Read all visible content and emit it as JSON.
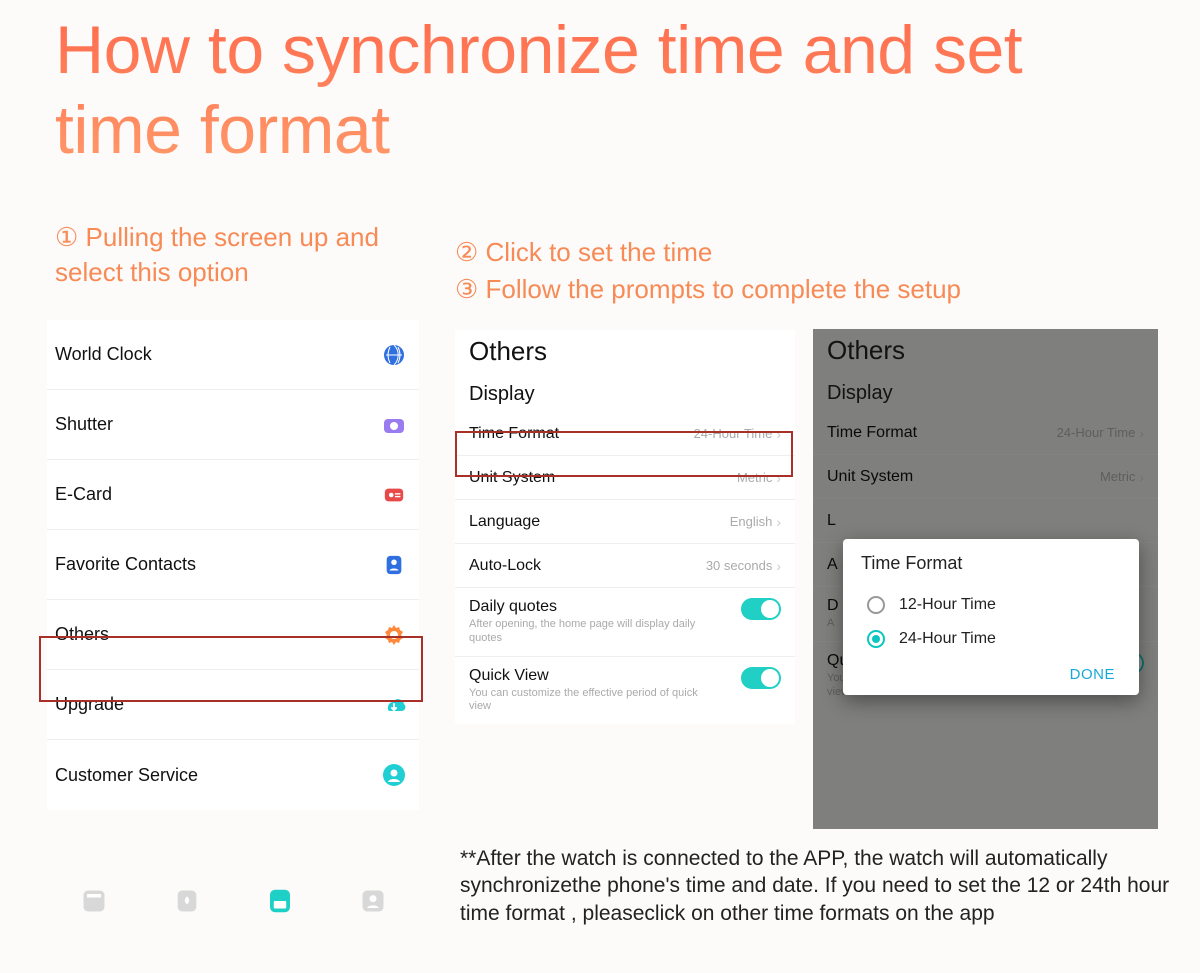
{
  "title": "How to synchronize time and set time format",
  "steps": {
    "s1": "① Pulling the screen up and select this option",
    "s2": "② Click to set the time",
    "s3": "③ Follow the prompts to complete the setup"
  },
  "menu": {
    "items": [
      {
        "label": "World Clock"
      },
      {
        "label": "Shutter"
      },
      {
        "label": "E-Card"
      },
      {
        "label": "Favorite Contacts"
      },
      {
        "label": "Others"
      },
      {
        "label": "Upgrade"
      },
      {
        "label": "Customer Service"
      }
    ]
  },
  "settings": {
    "header": "Others",
    "section": "Display",
    "rows": {
      "time_format": {
        "label": "Time Format",
        "value": "24-Hour Time"
      },
      "unit_system": {
        "label": "Unit System",
        "value": "Metric"
      },
      "language": {
        "label": "Language",
        "value": "English"
      },
      "auto_lock": {
        "label": "Auto-Lock",
        "value": "30 seconds"
      },
      "daily_quotes": {
        "label": "Daily quotes",
        "desc": "After opening, the home page will display daily quotes"
      },
      "quick_view": {
        "label": "Quick View",
        "desc": "You can customize the effective period of quick view"
      }
    }
  },
  "dialog": {
    "title": "Time Format",
    "opt1": "12-Hour Time",
    "opt2": "24-Hour Time",
    "done": "DONE"
  },
  "footnote": "**After the watch is connected to the APP, the watch will automatically synchronizethe phone's time and date. If you need to set the 12 or 24th hour time format , pleaseclick on other time formats on the app"
}
